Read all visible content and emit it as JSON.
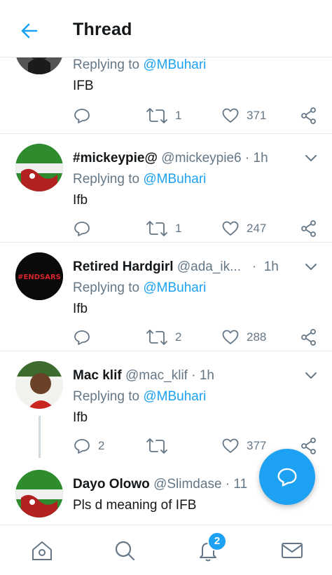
{
  "header": {
    "title": "Thread"
  },
  "tweets": [
    {
      "reply_prefix": "Replying to ",
      "reply_to": "@MBuhari",
      "text": "IFB",
      "retweets": "1",
      "likes": "371",
      "replies": ""
    },
    {
      "name": "#mickeypie@",
      "handle": "@mickeypie6",
      "time": "1h",
      "reply_prefix": "Replying to ",
      "reply_to": "@MBuhari",
      "text": "Ifb",
      "replies": "",
      "retweets": "1",
      "likes": "247"
    },
    {
      "name": "Retired Hardgirl",
      "handle": "@ada_ik...",
      "time": "1h",
      "reply_prefix": "Replying to ",
      "reply_to": "@MBuhari",
      "text": "Ifb",
      "replies": "",
      "retweets": "2",
      "likes": "288",
      "avatar_text": "#ENDSARS"
    },
    {
      "name": "Mac klif",
      "handle": "@mac_klif",
      "time": "1h",
      "reply_prefix": "Replying to ",
      "reply_to": "@MBuhari",
      "text": "Ifb",
      "replies": "2",
      "retweets": "",
      "likes": "377"
    },
    {
      "name": "Dayo Olowo",
      "handle": "@Slimdase",
      "time": "11",
      "text": "Pls d meaning of IFB"
    }
  ],
  "nav": {
    "notifications_badge": "2",
    "items": [
      "home-icon",
      "search-icon",
      "bell-icon",
      "mail-icon"
    ]
  },
  "colors": {
    "accent": "#1da1f2",
    "muted": "#657786"
  }
}
